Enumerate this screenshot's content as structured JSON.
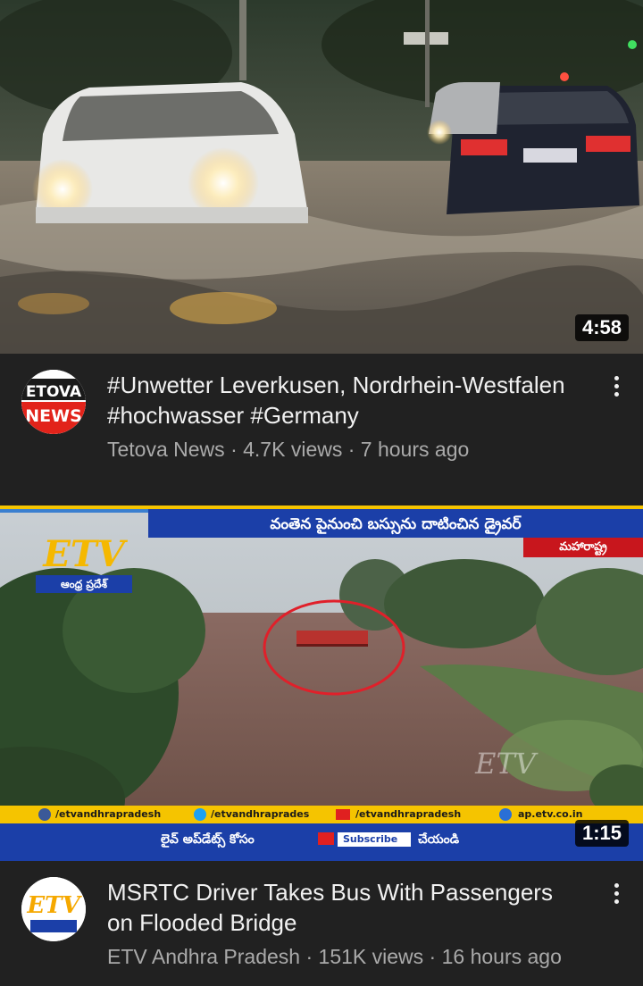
{
  "videos": [
    {
      "duration": "4:58",
      "title": "#Unwetter Leverkusen, Nordrhein-Westfalen #hochwasser #Germany",
      "channel": "Tetova News",
      "views": "4.7K views",
      "age": "7 hours ago",
      "avatar_icon": "tetova-news-logo",
      "thumbnail": {
        "description": "cars-driving-through-flooded-street"
      }
    },
    {
      "duration": "1:15",
      "title": "MSRTC Driver Takes Bus With Passengers on Flooded Bridge",
      "channel": "ETV Andhra Pradesh",
      "views": "151K views",
      "age": "16 hours ago",
      "avatar_icon": "etv-andhra-pradesh-logo",
      "thumbnail": {
        "description": "bus-on-flooded-bridge",
        "headline": "వంతెన పైనుంచి బస్సును దాటించిన డ్రైవర్",
        "region_tag": "మహారాష్ట్ర",
        "channel_tag": "ఆంధ్ర ప్రదేశ్",
        "social": [
          "/etvandhrapradesh",
          "/etvandhraprades",
          "/etvandhrapradesh",
          "ap.etv.co.in"
        ],
        "cta_left": "లైవ్ అప్‌డేట్స్ కోసం",
        "cta_button": "Subscribe",
        "cta_right": "చేయండి"
      }
    }
  ],
  "colors": {
    "background": "#212121",
    "etv_blue": "#1b3fa8",
    "etv_yellow": "#f5c400",
    "circle_red": "#e0202a"
  }
}
